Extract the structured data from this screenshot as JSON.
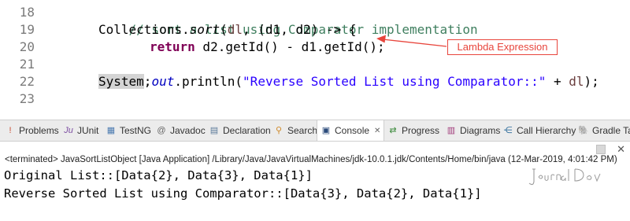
{
  "editor": {
    "line_numbers": [
      "18",
      "19",
      "20",
      "21",
      "22",
      "23"
    ],
    "lines": {
      "l18": "// sort a list using Comparator implementation",
      "l19_a": "Collections.",
      "l19_b": "sort",
      "l19_c": "(",
      "l19_d": "dl",
      "l19_e": ", (d1, d2) -> {",
      "l20_kw": "return",
      "l20_rest": " d2.getId() - d1.getId();",
      "l21": "});",
      "l22_a": "System",
      "l22_b": ".",
      "l22_c": "out",
      "l22_d": ".println(",
      "l22_e": "\"Reverse Sorted List using Comparator::\"",
      "l22_f": " + ",
      "l22_g": "dl",
      "l22_h": ");"
    },
    "annotation": "Lambda Expression",
    "colors": {
      "comment": "#3f7f5f",
      "keyword": "#7f0055",
      "string": "#2a00ff",
      "field": "#0000c0",
      "annotation": "#e8453c"
    }
  },
  "tabs": [
    {
      "label": "Problems",
      "icon": "problems-icon",
      "glyph": "!"
    },
    {
      "label": "JUnit",
      "icon": "junit-icon",
      "glyph": "Ju"
    },
    {
      "label": "TestNG",
      "icon": "testng-icon",
      "glyph": "▦"
    },
    {
      "label": "Javadoc",
      "icon": "javadoc-icon",
      "glyph": "@"
    },
    {
      "label": "Declaration",
      "icon": "declaration-icon",
      "glyph": "▤"
    },
    {
      "label": "Search",
      "icon": "search-icon",
      "glyph": "⚲"
    },
    {
      "label": "Console",
      "icon": "console-icon",
      "glyph": "▣",
      "close": "✕"
    },
    {
      "label": "Progress",
      "icon": "progress-icon",
      "glyph": "⇄"
    },
    {
      "label": "Diagrams",
      "icon": "diagrams-icon",
      "glyph": "▥"
    },
    {
      "label": "Call Hierarchy",
      "icon": "call-hierarchy-icon",
      "glyph": "⋲"
    },
    {
      "label": "Gradle Tas",
      "icon": "gradle-icon",
      "glyph": "🐘"
    }
  ],
  "console": {
    "terminated": "<terminated> JavaSortListObject [Java Application] /Library/Java/JavaVirtualMachines/jdk-10.0.1.jdk/Contents/Home/bin/java (12-Mar-2019, 4:01:42 PM)",
    "output": [
      "Original List::[Data{2}, Data{3}, Data{1}]",
      "Reverse Sorted List using Comparator::[Data{3}, Data{2}, Data{1}]"
    ],
    "controls": {
      "stop": "stop-icon",
      "close": "✕"
    }
  },
  "watermark": "JournalDev"
}
